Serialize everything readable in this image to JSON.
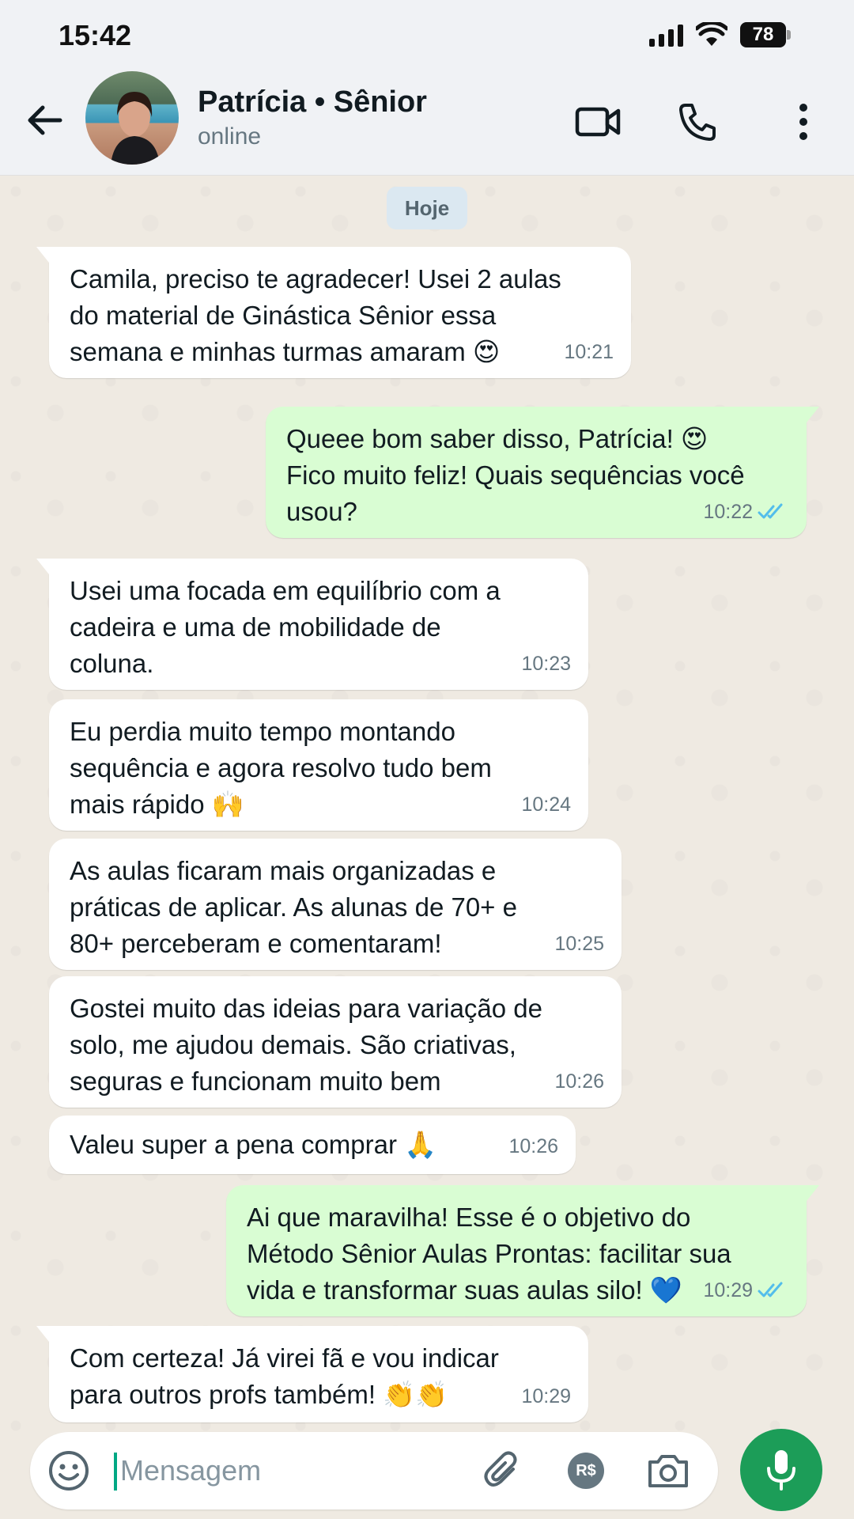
{
  "status_bar": {
    "time": "15:42",
    "battery": "78"
  },
  "header": {
    "contact_name": "Patrícia • Sênior",
    "contact_status": "online"
  },
  "chat": {
    "date_chip": "Hoje",
    "messages": [
      {
        "dir": "in",
        "text": "Camila, preciso te agradecer! Usei 2 aulas\ndo material de Ginástica Sênior essa\nsemana e minhas turmas amaram 😍",
        "time": "10:21"
      },
      {
        "dir": "out",
        "text": "Queee bom saber disso, Patrícia! 😍\nFico muito feliz! Quais sequências você\nusou?",
        "time": "10:22",
        "read": true
      },
      {
        "dir": "in",
        "text": "Usei uma focada em equilíbrio com a\ncadeira e uma de mobilidade de\ncoluna.",
        "time": "10:23"
      },
      {
        "dir": "in",
        "text": "Eu perdia muito tempo montando\nsequência e agora resolvo tudo bem\nmais rápido 🙌",
        "time": "10:24"
      },
      {
        "dir": "in",
        "text": "As aulas ficaram mais organizadas e\npráticas de aplicar. As alunas de 70+ e\n80+ perceberam e comentaram!",
        "time": "10:25"
      },
      {
        "dir": "in",
        "text": "Gostei muito das ideias para variação de\nsolo, me ajudou demais. São criativas,\nseguras e funcionam muito bem",
        "time": "10:26"
      },
      {
        "dir": "in",
        "text": "Valeu super a pena comprar 🙏",
        "time": "10:26"
      },
      {
        "dir": "out",
        "text": "Ai que maravilha! Esse é o objetivo do\nMétodo Sênior Aulas Prontas: facilitar sua\nvida e transformar suas aulas silo! 💙",
        "time": "10:29",
        "read": true
      },
      {
        "dir": "in",
        "text": "Com certeza! Já virei fã e vou indicar\npara outros profs também! 👏👏",
        "time": "10:29"
      }
    ]
  },
  "input": {
    "placeholder": "Mensagem",
    "pay_label": "R$"
  },
  "icons": {
    "back": "arrow-left-icon",
    "video": "video-camera-icon",
    "call": "phone-icon",
    "menu": "more-vertical-icon",
    "emoji": "emoji-icon",
    "attach": "paperclip-icon",
    "camera": "camera-icon",
    "mic": "microphone-icon",
    "read": "double-check-icon"
  },
  "colors": {
    "accent": "#00a884",
    "mic_button": "#1c9d58",
    "outgoing_bubble": "#d9fdd3",
    "read_check": "#53bdeb"
  }
}
